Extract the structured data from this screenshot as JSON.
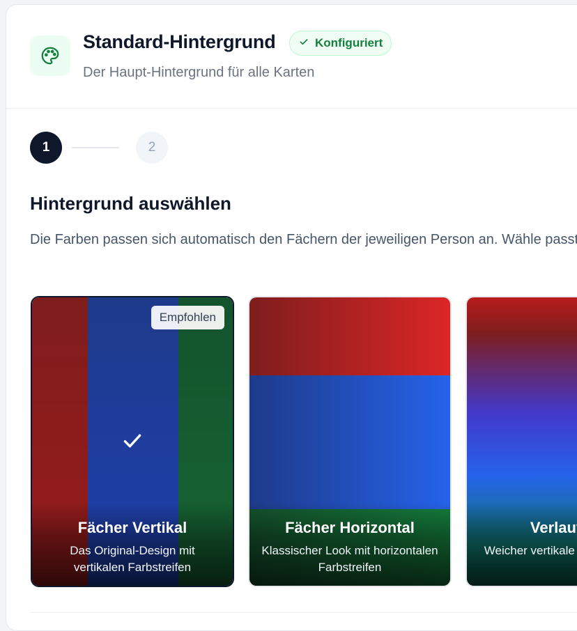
{
  "header": {
    "title": "Standard-Hintergrund",
    "status_badge": "Konfiguriert",
    "subtitle": "Der Haupt-Hintergrund für alle Karten",
    "icon": "palette-icon"
  },
  "stepper": {
    "steps": [
      {
        "label": "1",
        "state": "active"
      },
      {
        "label": "2",
        "state": "inactive"
      }
    ]
  },
  "section": {
    "title": "Hintergrund auswählen",
    "description": "Die Farben passen sich automatisch den Fächern der jeweiligen Person an. Wähle passt."
  },
  "options": [
    {
      "title": "Fächer Vertikal",
      "description": "Das Original-Design mit vertikalen Farbstreifen",
      "badge": "Empfohlen",
      "selected": true
    },
    {
      "title": "Fächer Horizontal",
      "description": "Klassischer Look mit horizontalen Farbstreifen",
      "selected": false
    },
    {
      "title": "Verlauf V",
      "description": "Weicher vertikale für moderne",
      "selected": false
    }
  ],
  "colors": {
    "accent_dark": "#0f172a",
    "success": "#15803d",
    "muted_text": "#6b7280"
  }
}
